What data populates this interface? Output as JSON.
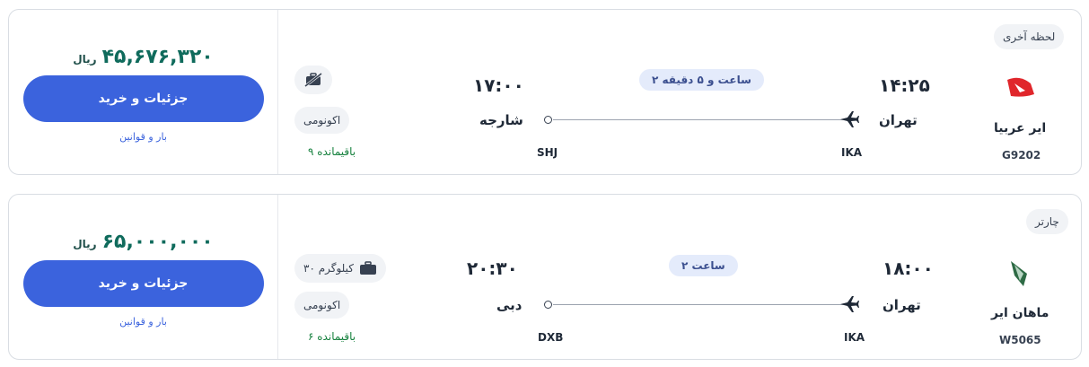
{
  "flights": [
    {
      "price_amount": "۴۵,۶۷۶,۳۲۰",
      "price_currency": "ریال",
      "buy_label": "جزئیات و خرید",
      "rules_label": "بار و قوانین",
      "baggage_label": "",
      "baggage_icon": "no-baggage-icon",
      "cabin_label": "اکونومی",
      "seats_label": "۹ باقیمانده",
      "arrival_time": "۱۷:۰۰",
      "arrival_city": "شارجه",
      "arrival_code": "SHJ",
      "departure_time": "۱۴:۲۵",
      "departure_city": "تهران",
      "departure_code": "IKA",
      "duration_label": "۲ ساعت و ۵ دقیقه",
      "airline_name": "ایر عربیا",
      "flight_number": "G9202",
      "tag_label": "لحظه آخری",
      "logo_icon": "air-arabia-logo",
      "logo_color": "#e0262b"
    },
    {
      "price_amount": "۶۵,۰۰۰,۰۰۰",
      "price_currency": "ریال",
      "buy_label": "جزئیات و خرید",
      "rules_label": "بار و قوانین",
      "baggage_label": "۳۰ کیلوگرم",
      "baggage_icon": "suitcase-icon",
      "cabin_label": "اکونومی",
      "seats_label": "۶ باقیمانده",
      "arrival_time": "۲۰:۳۰",
      "arrival_city": "دبی",
      "arrival_code": "DXB",
      "departure_time": "۱۸:۰۰",
      "departure_city": "تهران",
      "departure_code": "IKA",
      "duration_label": "۲ ساعت",
      "airline_name": "ماهان ایر",
      "flight_number": "W5065",
      "tag_label": "چارتر",
      "logo_icon": "mahan-air-logo",
      "logo_color": "#3c8a5c"
    }
  ],
  "colors": {
    "accent": "#3b63dd",
    "price": "#0f6b5c",
    "seats": "#15803d"
  }
}
